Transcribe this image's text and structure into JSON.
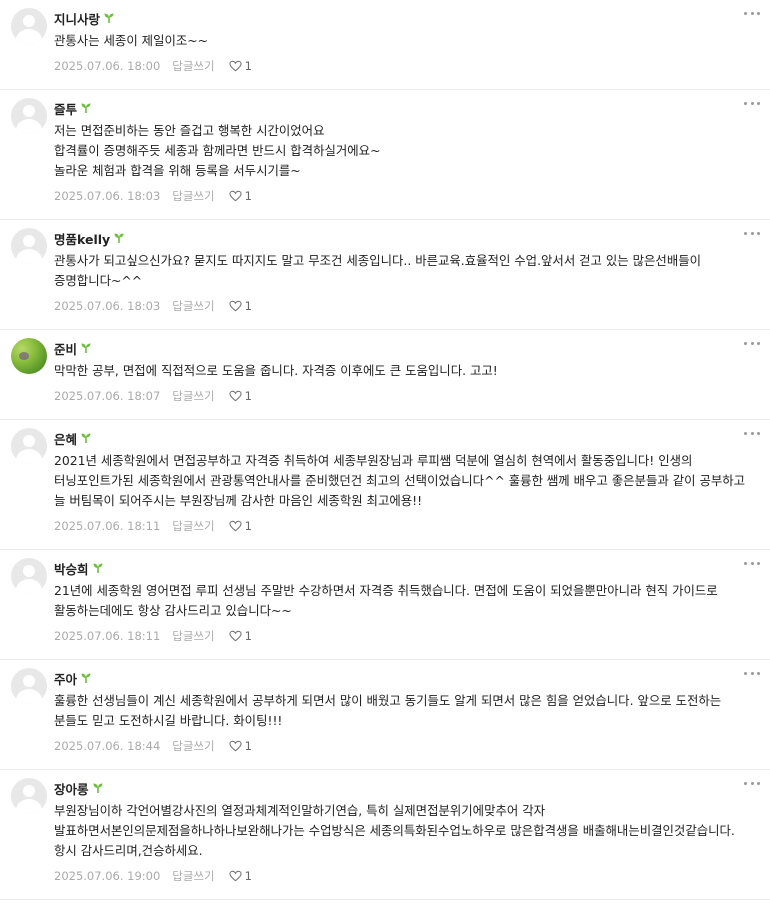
{
  "comments": [
    {
      "author": "지니사랑",
      "text": "관통사는 세종이 제일이조~~",
      "date": "2025.07.06. 18:00",
      "reply_label": "답글쓰기",
      "likes": "1",
      "avatar": "default-avatar"
    },
    {
      "author": "즐투",
      "text": "저는 면접준비하는 동안 즐겁고 행복한 시간이었어요\n합격률이 증명해주듯 세종과 함께라면 반드시 합격하실거에요~\n놀라운 체험과 합격을 위해 등록을 서두시기를~",
      "date": "2025.07.06. 18:03",
      "reply_label": "답글쓰기",
      "likes": "1",
      "avatar": "default-avatar"
    },
    {
      "author": "명품kelly",
      "text": "관통사가 되고싶으신가요? 묻지도 따지지도 말고 무조건 세종입니다.. 바른교육.효율적인 수업.앞서서 걷고 있는 많은선배들이 증명합니다~^^",
      "date": "2025.07.06. 18:03",
      "reply_label": "답글쓰기",
      "likes": "1",
      "avatar": "default-avatar"
    },
    {
      "author": "준비",
      "text": "막막한 공부, 면접에 직접적으로 도움을 줍니다. 자격증 이후에도 큰 도움입니다. 고고!",
      "date": "2025.07.06. 18:07",
      "reply_label": "답글쓰기",
      "likes": "1",
      "avatar": "photo-avatar"
    },
    {
      "author": "은혜",
      "text": "2021년 세종학원에서 면접공부하고 자격증 취득하여 세종부원장님과 루피쌤 덕분에 열심히 현역에서 활동중입니다! 인생의 터닝포인트가된 세종학원에서 관광통역안내사를 준비했던건 최고의 선택이었습니다^^ 훌륭한 쌤께 배우고 좋은분들과 같이 공부하고 늘 버팀목이 되어주시는 부원장님께 감사한 마음인 세종학원 최고에용!!",
      "date": "2025.07.06. 18:11",
      "reply_label": "답글쓰기",
      "likes": "1",
      "avatar": "default-avatar"
    },
    {
      "author": "박승희",
      "text": "21년에 세종학원 영어면접 루피 선생님 주말반 수강하면서 자격증 취득했습니다. 면접에 도움이 되었을뿐만아니라 현직 가이드로 활동하는데에도 항상 감사드리고 있습니다~~",
      "date": "2025.07.06. 18:11",
      "reply_label": "답글쓰기",
      "likes": "1",
      "avatar": "default-avatar"
    },
    {
      "author": "주아",
      "text": "훌륭한 선생님들이 계신 세종학원에서 공부하게 되면서 많이 배웠고 동기들도 알게 되면서 많은 힘을 얻었습니다. 앞으로 도전하는 분들도 믿고 도전하시길 바랍니다. 화이팅!!!",
      "date": "2025.07.06. 18:44",
      "reply_label": "답글쓰기",
      "likes": "1",
      "avatar": "default-avatar"
    },
    {
      "author": "장아롱",
      "text": "부원장님이하 각언어별강사진의 열정과체계적인말하기연습, 특히 실제면접분위기에맞추어 각자 발표하면서본인의문제점을하나하나보완해나가는 수업방식은 세종의특화된수업노하우로 많은합격생을 배출해내는비결인것같습니다. 항시 감사드리며,건승하세요.",
      "date": "2025.07.06. 19:00",
      "reply_label": "답글쓰기",
      "likes": "1",
      "avatar": "default-avatar"
    }
  ],
  "colors": {
    "author": "#222222",
    "meta": "#aaaaaa",
    "sprout": "#6cbf3c",
    "divider": "#ececec"
  },
  "icons": {
    "sprout": "sprout-icon",
    "more": "more-options-icon",
    "heart": "heart-icon"
  }
}
